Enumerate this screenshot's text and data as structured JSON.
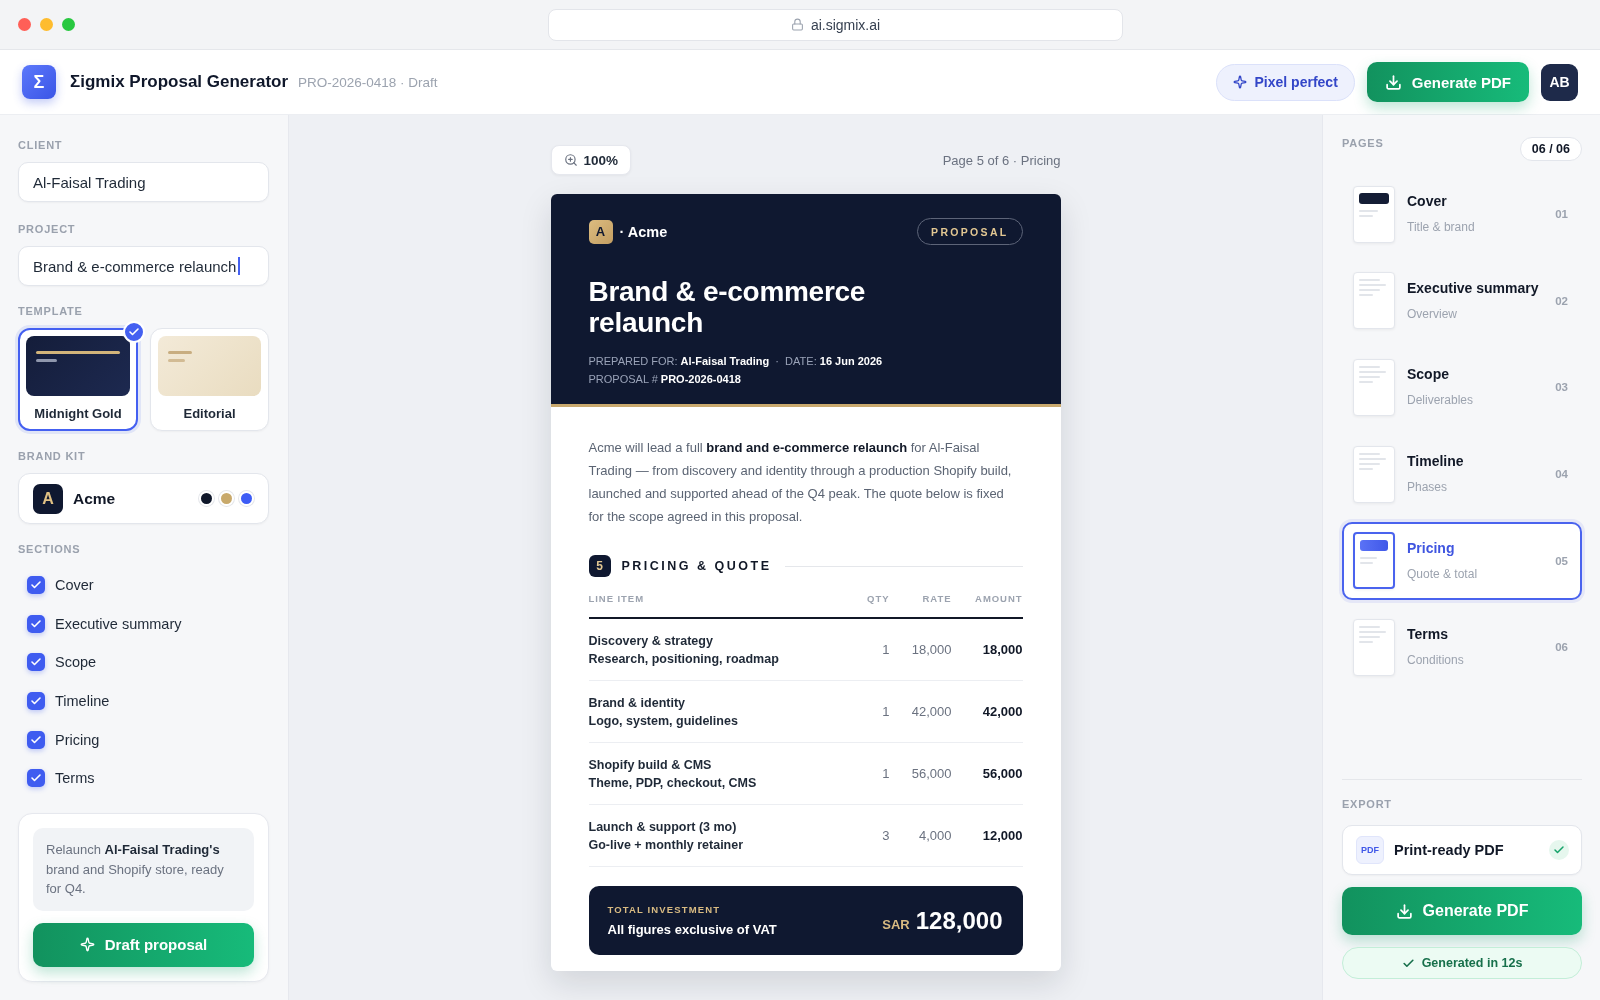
{
  "browser": {
    "url": "ai.sigmix.ai"
  },
  "header": {
    "logo": "Σ",
    "title": "Σigmix Proposal Generator",
    "subtitle": "PRO-2026-0418 · Draft",
    "actions": {
      "pixel_perfect": "Pixel perfect",
      "generate": "Generate PDF"
    },
    "avatar": "AB"
  },
  "sidebar": {
    "client": {
      "label": "CLIENT",
      "value": "Al-Faisal Trading"
    },
    "project": {
      "label": "PROJECT",
      "value": "Brand & e-commerce relaunch",
      "focused": true
    },
    "template": {
      "label": "TEMPLATE",
      "options": [
        {
          "name": "Midnight Gold",
          "kind": "dark",
          "selected": true
        },
        {
          "name": "Editorial",
          "kind": "light",
          "selected": false
        }
      ]
    },
    "brand_kit": {
      "label": "BRAND KIT",
      "logo": "A",
      "name": "Acme",
      "swatches": [
        {
          "color": "#0f172a"
        },
        {
          "color": "#c8a96b"
        },
        {
          "color": "#3d5cf5"
        }
      ]
    },
    "sections": {
      "label": "SECTIONS",
      "items": [
        {
          "label": "Cover",
          "checked": true
        },
        {
          "label": "Executive summary",
          "checked": true
        },
        {
          "label": "Scope",
          "checked": true
        },
        {
          "label": "Timeline",
          "checked": true
        },
        {
          "label": "Pricing",
          "checked": true
        },
        {
          "label": "Terms",
          "checked": true
        }
      ]
    },
    "prompt": {
      "text": "Relaunch **Al-Faisal Trading's** brand and Shopify store, ready for Q4.",
      "button": "Draft proposal"
    }
  },
  "preview": {
    "zoom": "100%",
    "page_indicator": "Page 5 of 6 · Pricing",
    "document": {
      "logo": "A",
      "brand": "· Acme",
      "tag": "PROPOSAL",
      "title": "Brand & e-commerce relaunch",
      "meta": [
        "PREPARED FOR: **Al-Faisal Trading**  ·  DATE: **16 Jun 2026**",
        "PROPOSAL # **PRO-2026-0418**"
      ],
      "intro": "Acme will lead a full **brand and e-commerce relaunch** for Al-Faisal Trading — from discovery and identity through a production Shopify build, launched and supported ahead of the Q4 peak. The quote below is fixed for the scope agreed in this proposal.",
      "section": {
        "number": "5",
        "title": "PRICING & QUOTE"
      },
      "table": {
        "columns": [
          "LINE ITEM",
          "QTY",
          "RATE",
          "AMOUNT"
        ],
        "rows": [
          {
            "item": "Discovery & strategy",
            "detail": "Research, positioning, roadmap",
            "qty": "1",
            "rate": "18,000",
            "amount": "18,000"
          },
          {
            "item": "Brand & identity",
            "detail": "Logo, system, guidelines",
            "qty": "1",
            "rate": "42,000",
            "amount": "42,000"
          },
          {
            "item": "Shopify build & CMS",
            "detail": "Theme, PDP, checkout, CMS",
            "qty": "1",
            "rate": "56,000",
            "amount": "56,000"
          },
          {
            "item": "Launch & support (3 mo)",
            "detail": "Go-live + monthly retainer",
            "qty": "3",
            "rate": "4,000",
            "amount": "12,000"
          }
        ]
      },
      "total": {
        "label": "TOTAL INVESTMENT",
        "note": "All figures exclusive of VAT",
        "currency": "SAR",
        "amount": "128,000"
      }
    }
  },
  "pages": {
    "label": "PAGES",
    "count": "06 / 06",
    "items": [
      {
        "title": "Cover",
        "subtitle": "Title & brand",
        "number": "01",
        "kind": "header",
        "selected": false
      },
      {
        "title": "Executive summary",
        "subtitle": "Overview",
        "number": "02",
        "kind": "text",
        "selected": false
      },
      {
        "title": "Scope",
        "subtitle": "Deliverables",
        "number": "03",
        "kind": "text",
        "selected": false
      },
      {
        "title": "Timeline",
        "subtitle": "Phases",
        "number": "04",
        "kind": "text",
        "selected": false
      },
      {
        "title": "Pricing",
        "subtitle": "Quote & total",
        "number": "05",
        "kind": "header",
        "selected": true
      },
      {
        "title": "Terms",
        "subtitle": "Conditions",
        "number": "06",
        "kind": "text",
        "selected": false
      }
    ]
  },
  "export": {
    "label": "EXPORT",
    "format": {
      "badge": "PDF",
      "label": "Print-ready PDF",
      "checked": true
    },
    "button": "Generate PDF",
    "status": "Generated in 12s"
  }
}
